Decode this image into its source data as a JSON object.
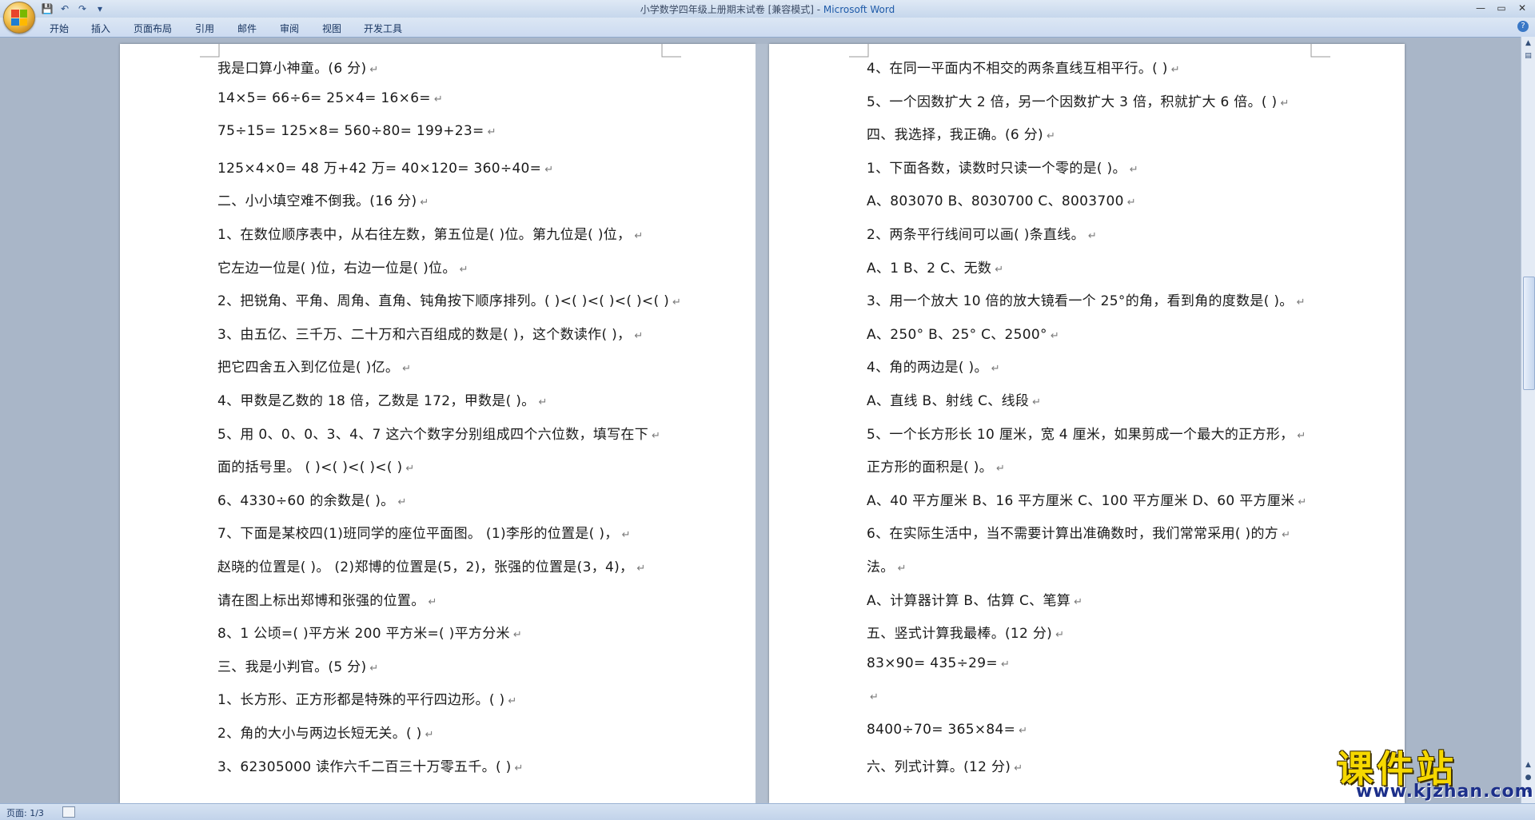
{
  "window": {
    "title": "小学数学四年级上册期末试卷 [兼容模式] - ",
    "app_name": "Microsoft Word",
    "minimize": "—",
    "restore": "▭",
    "close": "✕"
  },
  "qat": {
    "save": "💾",
    "undo": "↶",
    "redo": "↷",
    "customize": "▾"
  },
  "tabs": [
    "开始",
    "插入",
    "页面布局",
    "引用",
    "邮件",
    "审阅",
    "视图",
    "开发工具"
  ],
  "help": "?",
  "page_left": [
    "我是口算小神童。(6 分)",
    "14×5=        66÷6=        25×4=        16×6=",
    "75÷15=       125×8=       560÷80=      199+23=",
    "125×4×0=       48 万+42 万=       40×120=       360÷40=",
    "二、小小填空难不倒我。(16 分)",
    "1、在数位顺序表中，从右往左数，第五位是( )位。第九位是( )位，",
    "它左边一位是( )位，右边一位是( )位。",
    "2、把锐角、平角、周角、直角、钝角按下顺序排列。( )<( )<( )<( )<( )",
    "3、由五亿、三千万、二十万和六百组成的数是( )，这个数读作( )，",
    "把它四舍五入到亿位是( )亿。",
    "4、甲数是乙数的 18 倍，乙数是 172，甲数是( )。",
    "5、用 0、0、0、3、4、7 这六个数字分别组成四个六位数，填写在下",
    "面的括号里。 ( )<( )<( )<( )",
    "6、4330÷60 的余数是( )。",
    "7、下面是某校四(1)班同学的座位平面图。 (1)李彤的位置是( )，",
    "赵晓的位置是( )。 (2)郑博的位置是(5，2)，张强的位置是(3，4)，",
    "请在图上标出郑博和张强的位置。",
    "8、1 公顷=( )平方米 200 平方米=( )平方分米",
    "三、我是小判官。(5 分)",
    "1、长方形、正方形都是特殊的平行四边形。( )",
    "2、角的大小与两边长短无关。( )",
    " 3、62305000 读作六千二百三十万零五千。( )"
  ],
  "page_right": [
    "4、在同一平面内不相交的两条直线互相平行。( )",
    "5、一个因数扩大 2 倍，另一个因数扩大 3 倍，积就扩大 6 倍。( )",
    " 四、我选择，我正确。(6 分)",
    "1、下面各数，读数时只读一个零的是( )。",
    "A、803070 B、8030700 C、8003700",
    " 2、两条平行线间可以画( )条直线。",
    "A、1 B、2 C、无数",
    "3、用一个放大 10 倍的放大镜看一个 25°的角，看到角的度数是( )。",
    " A、250°  B、25°  C、2500°",
    " 4、角的两边是( )。",
    "A、直线 B、射线 C、线段",
    "5、一个长方形长 10 厘米，宽 4 厘米，如果剪成一个最大的正方形，",
    "正方形的面积是( )。",
    " A、40 平方厘米 B、16 平方厘米 C、100 平方厘米 D、60 平方厘米",
    "6、在实际生活中，当不需要计算出准确数时，我们常常采用( )的方",
    "法。",
    " A、计算器计算 B、估算 C、笔算",
    "五、竖式计算我最棒。(12 分)",
    "83×90=             435÷29=",
    "",
    "8400÷70=           365×84=",
    "六、列式计算。(12 分)"
  ],
  "paragraph_mark": "↵",
  "status": {
    "page": "页面: 1/3"
  },
  "watermark": {
    "text": "课件站",
    "url": "www.kjzhan.com"
  },
  "colors": {
    "ribbon": "#cbdaf0",
    "background": "#a9b6c8",
    "watermark_yellow": "#f6d800",
    "watermark_blue": "#1c2f8a"
  }
}
